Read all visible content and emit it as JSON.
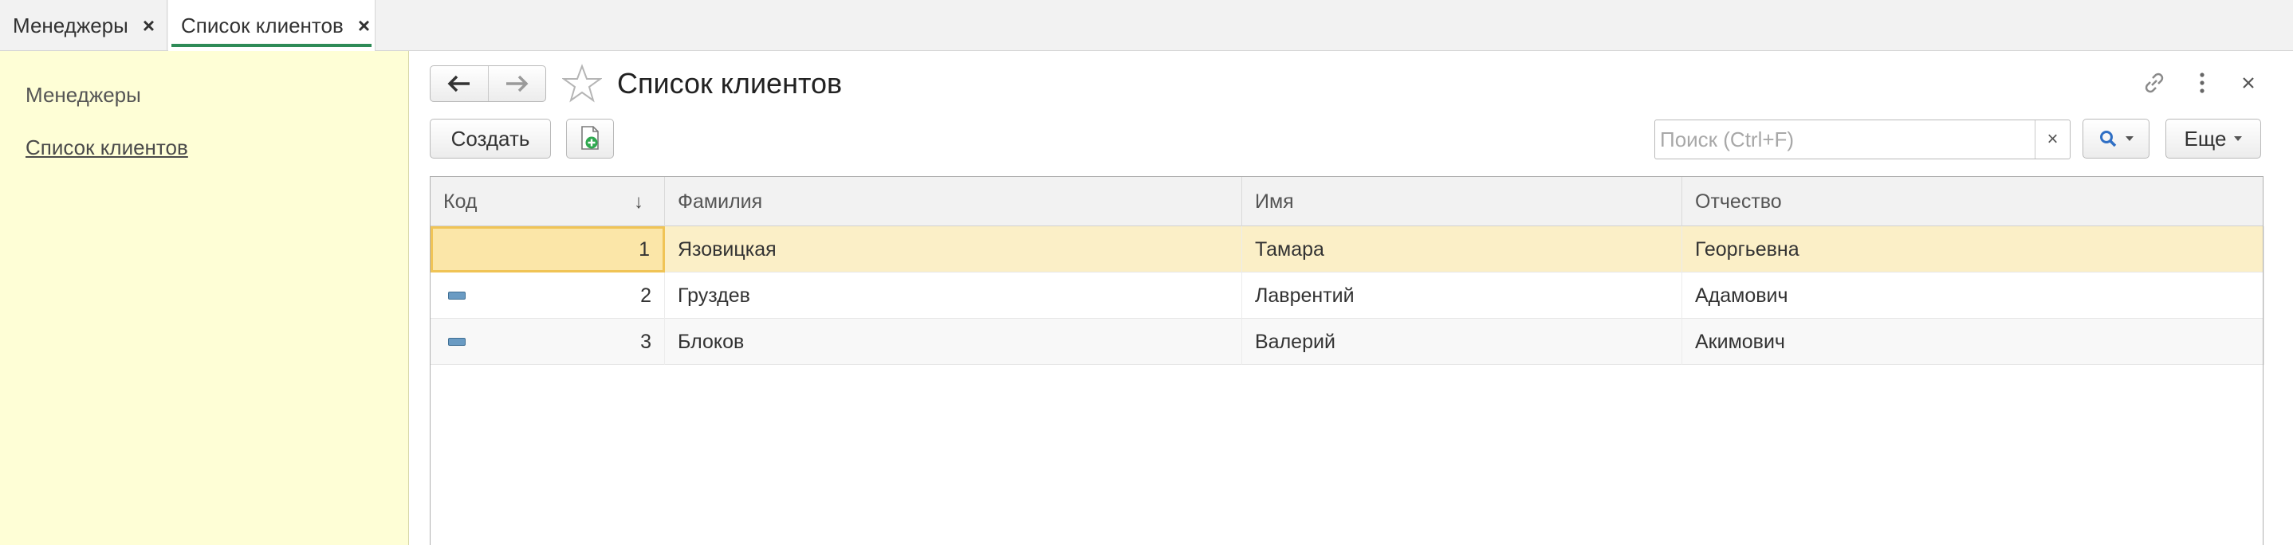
{
  "tabs": [
    {
      "label": "Менеджеры",
      "close": "×"
    },
    {
      "label": "Список клиентов",
      "close": "×"
    }
  ],
  "sidebar": {
    "items": [
      {
        "label": "Менеджеры"
      },
      {
        "label": "Список клиентов"
      }
    ]
  },
  "header": {
    "title": "Список клиентов"
  },
  "toolbar": {
    "create_label": "Создать",
    "search_placeholder": "Поиск (Ctrl+F)",
    "search_value": "",
    "search_clear": "×",
    "more_label": "Еще"
  },
  "table": {
    "columns": [
      "Код",
      "Фамилия",
      "Имя",
      "Отчество"
    ],
    "sort_indicator": "↓",
    "rows": [
      {
        "code": "1",
        "last": "Язовицкая",
        "first": "Тамара",
        "middle": "Георгьевна",
        "selected": true
      },
      {
        "code": "2",
        "last": "Груздев",
        "first": "Лаврентий",
        "middle": "Адамович",
        "selected": false
      },
      {
        "code": "3",
        "last": "Блоков",
        "first": "Валерий",
        "middle": "Акимович",
        "selected": false
      }
    ]
  },
  "colors": {
    "sidebar_bg": "#fefed6",
    "selected_row": "#fbefc7",
    "active_tab_underline": "#2e8b57",
    "copy_icon_green": "#2fa84f"
  },
  "icons": [
    "back-arrow-icon",
    "forward-arrow-icon",
    "star-icon",
    "link-icon",
    "more-vert-icon",
    "close-icon",
    "copy-add-icon",
    "search-icon",
    "row-item-icon"
  ]
}
